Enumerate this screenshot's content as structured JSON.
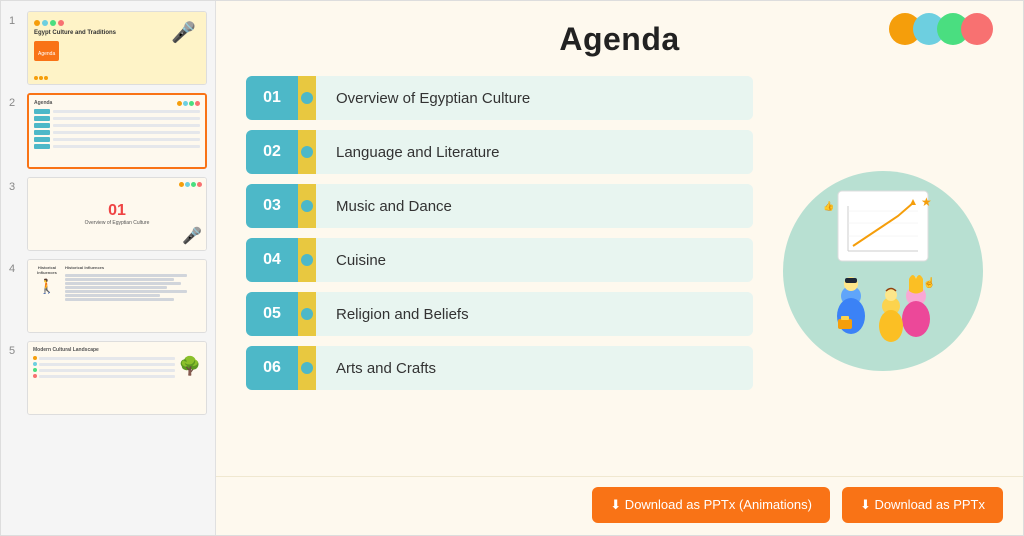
{
  "sidebar": {
    "slides": [
      {
        "num": "1",
        "type": "title"
      },
      {
        "num": "2",
        "type": "agenda"
      },
      {
        "num": "3",
        "type": "overview"
      },
      {
        "num": "4",
        "type": "historical"
      },
      {
        "num": "5",
        "type": "modern"
      }
    ]
  },
  "main": {
    "title": "Agenda",
    "agenda_items": [
      {
        "num": "01",
        "label": "Overview of Egyptian Culture"
      },
      {
        "num": "02",
        "label": "Language and Literature"
      },
      {
        "num": "03",
        "label": "Music and Dance"
      },
      {
        "num": "04",
        "label": "Cuisine"
      },
      {
        "num": "05",
        "label": "Religion and Beliefs"
      },
      {
        "num": "06",
        "label": "Arts and Crafts"
      }
    ],
    "deco_circles": [
      {
        "color": "#f59e0b"
      },
      {
        "color": "#6dcfe0"
      },
      {
        "color": "#4ade80"
      },
      {
        "color": "#f87171"
      }
    ],
    "footer": {
      "btn1_label": "⬇ Download as PPTx (Animations)",
      "btn2_label": "⬇ Download as PPTx"
    }
  },
  "slide1": {
    "title": "Egypt Culture and Traditions",
    "subtitle": "Agenda"
  },
  "slide3": {
    "num": "01",
    "text": "Overview of Egyptian Culture"
  },
  "slide4": {
    "title": "Historical Influences"
  },
  "slide5": {
    "title": "Modern Cultural Landscape"
  }
}
